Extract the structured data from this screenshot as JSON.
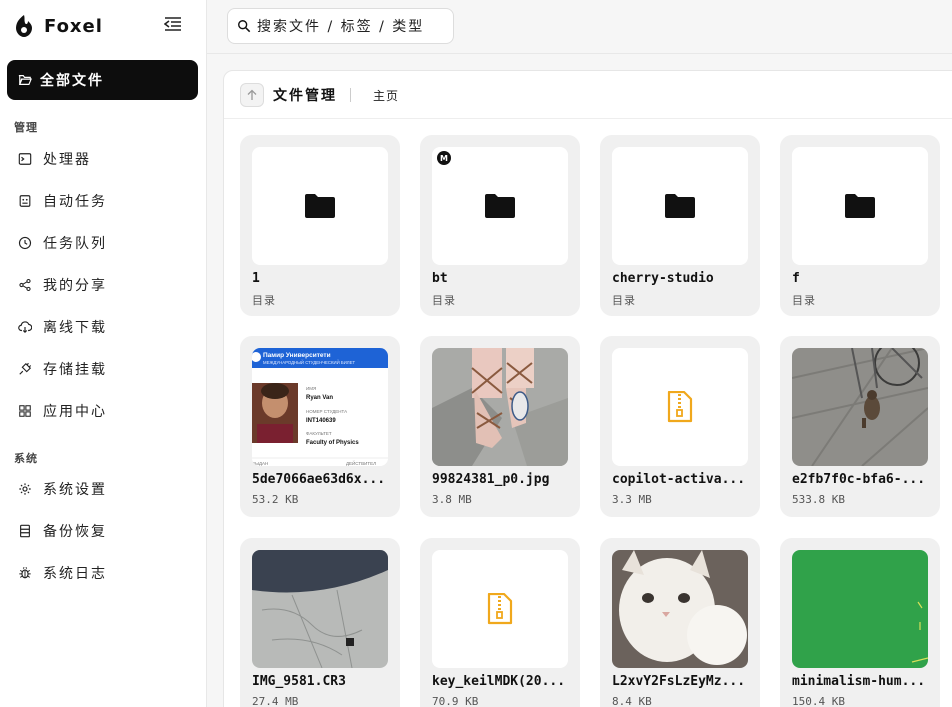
{
  "app": {
    "name": "Foxel"
  },
  "sidebar": {
    "active_item": {
      "label": "全部文件",
      "icon": "folder-open-icon"
    },
    "sections": [
      {
        "label": "管理",
        "items": [
          {
            "label": "处理器",
            "icon": "terminal-icon"
          },
          {
            "label": "自动任务",
            "icon": "robot-icon"
          },
          {
            "label": "任务队列",
            "icon": "clock-icon"
          },
          {
            "label": "我的分享",
            "icon": "share-icon"
          },
          {
            "label": "离线下载",
            "icon": "cloud-download-icon"
          },
          {
            "label": "存储挂载",
            "icon": "plug-icon"
          },
          {
            "label": "应用中心",
            "icon": "apps-grid-icon"
          }
        ]
      },
      {
        "label": "系统",
        "items": [
          {
            "label": "系统设置",
            "icon": "gear-icon"
          },
          {
            "label": "备份恢复",
            "icon": "database-icon"
          },
          {
            "label": "系统日志",
            "icon": "bug-icon"
          }
        ]
      }
    ]
  },
  "search": {
    "placeholder": "搜索文件 / 标签 / 类型"
  },
  "panel": {
    "title": "文件管理",
    "breadcrumb": "主页"
  },
  "files": [
    {
      "name": "1",
      "meta": "目录",
      "kind": "folder"
    },
    {
      "name": "bt",
      "meta": "目录",
      "kind": "folder",
      "badge": "M"
    },
    {
      "name": "cherry-studio",
      "meta": "目录",
      "kind": "folder"
    },
    {
      "name": "f",
      "meta": "目录",
      "kind": "folder"
    },
    {
      "name": "5de7066ae63d6x...",
      "meta": "53.2 KB",
      "kind": "image-idcard",
      "card_text": {
        "university": "Памир Университети",
        "subtitle": "МЕЖДУНАРОДНЫЙ СТУДЕНЧЕСКИЙ БИЛЕТ",
        "name_label": "ИМЯ",
        "name": "Ryan Van",
        "id_label": "НОМЕР СТУДЕНТА",
        "id": "INT140639",
        "faculty_label": "ФАКУЛЬТЕТ",
        "faculty": "Faculty of Physics",
        "footer_left": "ВЫДАН",
        "footer_right": "ДЕЙСТВИТЕЛ"
      }
    },
    {
      "name": "99824381_p0.jpg",
      "meta": "3.8 MB",
      "kind": "image-sandals"
    },
    {
      "name": "copilot-activa...",
      "meta": "3.3 MB",
      "kind": "archive"
    },
    {
      "name": "e2fb7f0c-bfa6-...",
      "meta": "533.8 KB",
      "kind": "image-cat-street"
    },
    {
      "name": "IMG_9581.CR3",
      "meta": "27.4 MB",
      "kind": "image-marble"
    },
    {
      "name": "key_keilMDK(20...",
      "meta": "70.9 KB",
      "kind": "archive"
    },
    {
      "name": "L2xvY2FsLzEyMz...",
      "meta": "8.4 KB",
      "kind": "image-cat-white"
    },
    {
      "name": "minimalism-hum...",
      "meta": "150.4 KB",
      "kind": "image-green"
    }
  ],
  "colors": {
    "accent_dark": "#0d0d0d",
    "archive_icon": "#f0a81c",
    "id_blue": "#1e63d6",
    "green_image": "#30a24a"
  }
}
